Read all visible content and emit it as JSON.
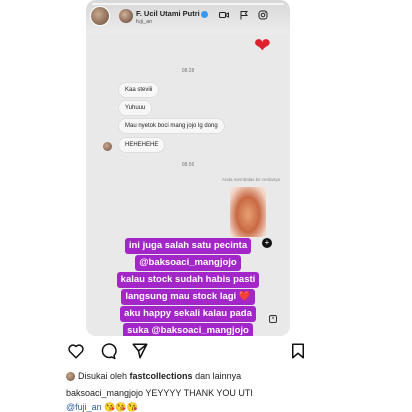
{
  "story": {
    "header": {
      "name": "F. Ucil Utami Putri",
      "username": "fuji_an",
      "icons": [
        "video-icon",
        "flag-icon",
        "instagram-icon"
      ]
    },
    "reaction_emoji": "❤",
    "chat": [
      {
        "type": "timestamp",
        "text": "08.28"
      },
      {
        "type": "message",
        "text": "Kaa steviii"
      },
      {
        "type": "message",
        "text": "Yuhuuu"
      },
      {
        "type": "message",
        "text": "Mau nyetok boci mang jojo lg dong"
      },
      {
        "type": "message",
        "text": "HEHEHEHE"
      },
      {
        "type": "timestamp",
        "text": "08.56"
      }
    ],
    "reply_note": "Anda membalas ke ceritanya",
    "caption_lines": [
      "ini juga salah satu pecinta",
      "@baksoaci_mangjojo",
      "kalau stock sudah habis pasti",
      "langsung mau stock lagi",
      "aku happy sekali kalau pada",
      "suka @baksoaci_mangjojo"
    ],
    "caption_heart": "❤️"
  },
  "actions": {
    "like_icon": "♡",
    "comment_icon": "◯",
    "share_icon": "➢",
    "save_icon": "⬒"
  },
  "likes": {
    "prefix": "Disukai oleh ",
    "user": "fastcollections",
    "suffix": " dan lainnya"
  },
  "comment": {
    "user": "baksoaci_mangjojo",
    "text": " YEYYYY THANK YOU UTI",
    "mention": "@fuji_an",
    "emojis": "😘😘😘"
  }
}
